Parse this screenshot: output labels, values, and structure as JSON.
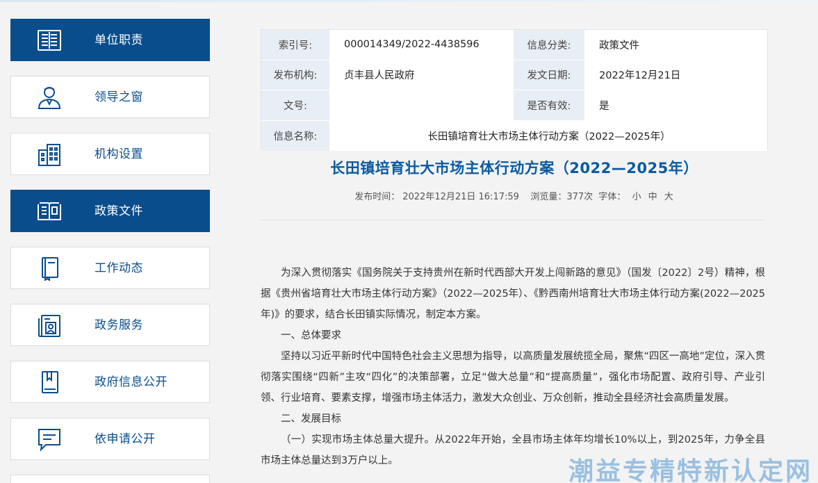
{
  "sidebar": {
    "items": [
      {
        "label": "单位职责",
        "icon": "newspaper-icon",
        "active": true
      },
      {
        "label": "领导之窗",
        "icon": "person-icon",
        "active": false
      },
      {
        "label": "机构设置",
        "icon": "building-icon",
        "active": false
      },
      {
        "label": "政策文件",
        "icon": "open-book-icon",
        "active": true
      },
      {
        "label": "工作动态",
        "icon": "notebook-icon",
        "active": false
      },
      {
        "label": "政务服务",
        "icon": "id-card-icon",
        "active": false
      },
      {
        "label": "政府信息公开",
        "icon": "bookmark-book-icon",
        "active": false
      },
      {
        "label": "依申请公开",
        "icon": "chat-bubble-icon",
        "active": false
      }
    ]
  },
  "info": {
    "index_label": "索引号:",
    "index_value": "000014349/2022-4438596",
    "category_label": "信息分类:",
    "category_value": "政策文件",
    "publisher_label": "发布机构:",
    "publisher_value": "贞丰县人民政府",
    "date_label": "发文日期:",
    "date_value": "2022年12月21日",
    "docno_label": "文号:",
    "docno_value": "",
    "valid_label": "是否有效:",
    "valid_value": "是",
    "name_label": "信息名称:",
    "name_value": "长田镇培育壮大市场主体行动方案（2022—2025年）"
  },
  "article": {
    "title": "长田镇培育壮大市场主体行动方案（2022—2025年）",
    "meta_time_label": "发布时间：",
    "meta_time": "2022年12月21日 16:17:59",
    "meta_views": "浏览量：377次",
    "meta_font_label": "字体：",
    "font_small": "小",
    "font_medium": "中",
    "font_large": "大",
    "paragraphs": [
      "为深入贯彻落实《国务院关于支持贵州在新时代西部大开发上闯新路的意见》（国发〔2022〕2号）精神，根据《贵州省培育壮大市场主体行动方案》（2022—2025年）、《黔西南州培育壮大市场主体行动方案(2022—2025年)》的要求，结合长田镇实际情况，制定本方案。",
      "一、总体要求",
      "坚持以习近平新时代中国特色社会主义思想为指导，以高质量发展统揽全局，聚焦“四区一高地”定位，深入贯彻落实围绕“四新”主攻“四化”的决策部署，立足“做大总量”和“提高质量”，强化市场配置、政府引导、产业引领、行业培育、要素支撑，增强市场主体活力，激发大众创业、万众创新，推动全县经济社会高质量发展。",
      "二、发展目标",
      "（一）实现市场主体总量大提升。从2022年开始，全县市场主体年均增长10%以上，到2025年，力争全县市场主体总量达到3万户以上。"
    ]
  },
  "watermark": "潮益专精特新认定网",
  "colors": {
    "primary": "#0a4d8c",
    "title": "#0a5aa0",
    "label_bg": "#e8eef5"
  }
}
